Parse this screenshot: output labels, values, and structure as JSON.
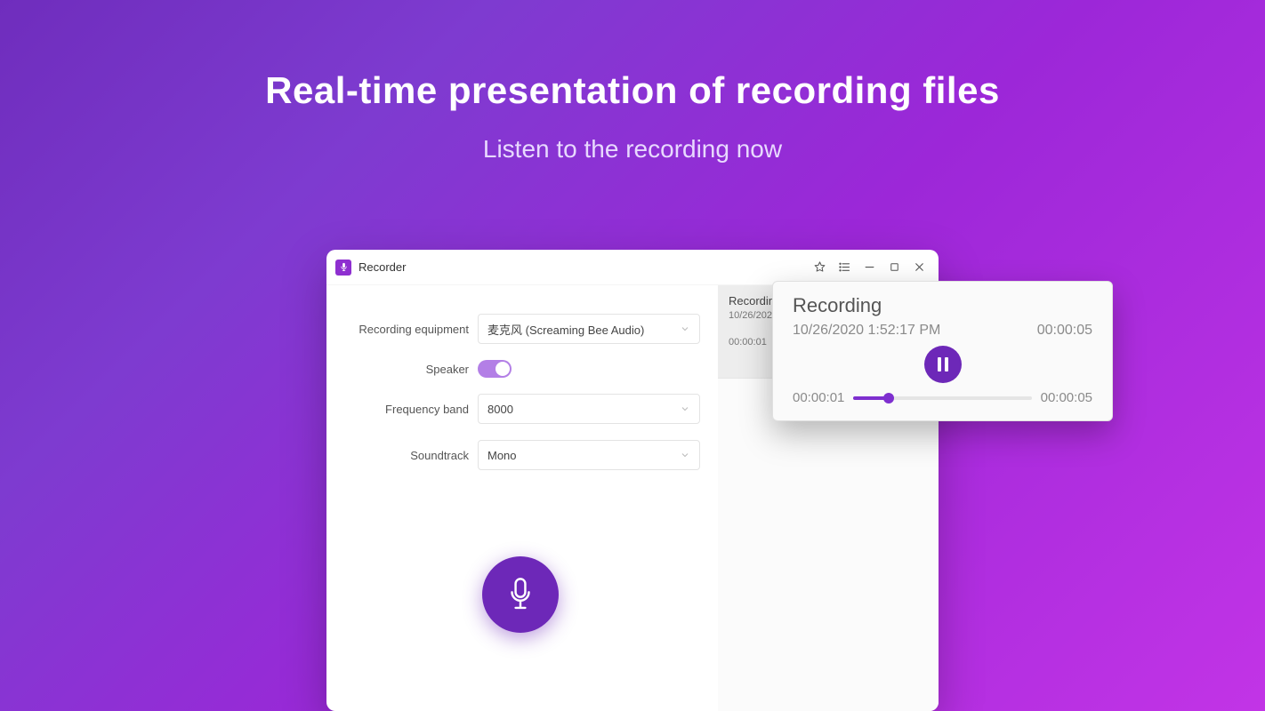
{
  "hero": {
    "title": "Real-time presentation of recording files",
    "subtitle": "Listen to the recording now"
  },
  "window": {
    "title": "Recorder"
  },
  "form": {
    "equipment_label": "Recording equipment",
    "equipment_value": "麦克风 (Screaming Bee Audio)",
    "speaker_label": "Speaker",
    "speaker_on": true,
    "freq_label": "Frequency band",
    "freq_value": "8000",
    "soundtrack_label": "Soundtrack",
    "soundtrack_value": "Mono"
  },
  "list_item": {
    "title": "Recordin",
    "date": "10/26/202",
    "time": "00:00:01"
  },
  "player": {
    "title": "Recording",
    "datetime": "10/26/2020 1:52:17 PM",
    "duration_top": "00:00:05",
    "elapsed": "00:00:01",
    "duration_bottom": "00:00:05",
    "progress_percent": 20
  }
}
